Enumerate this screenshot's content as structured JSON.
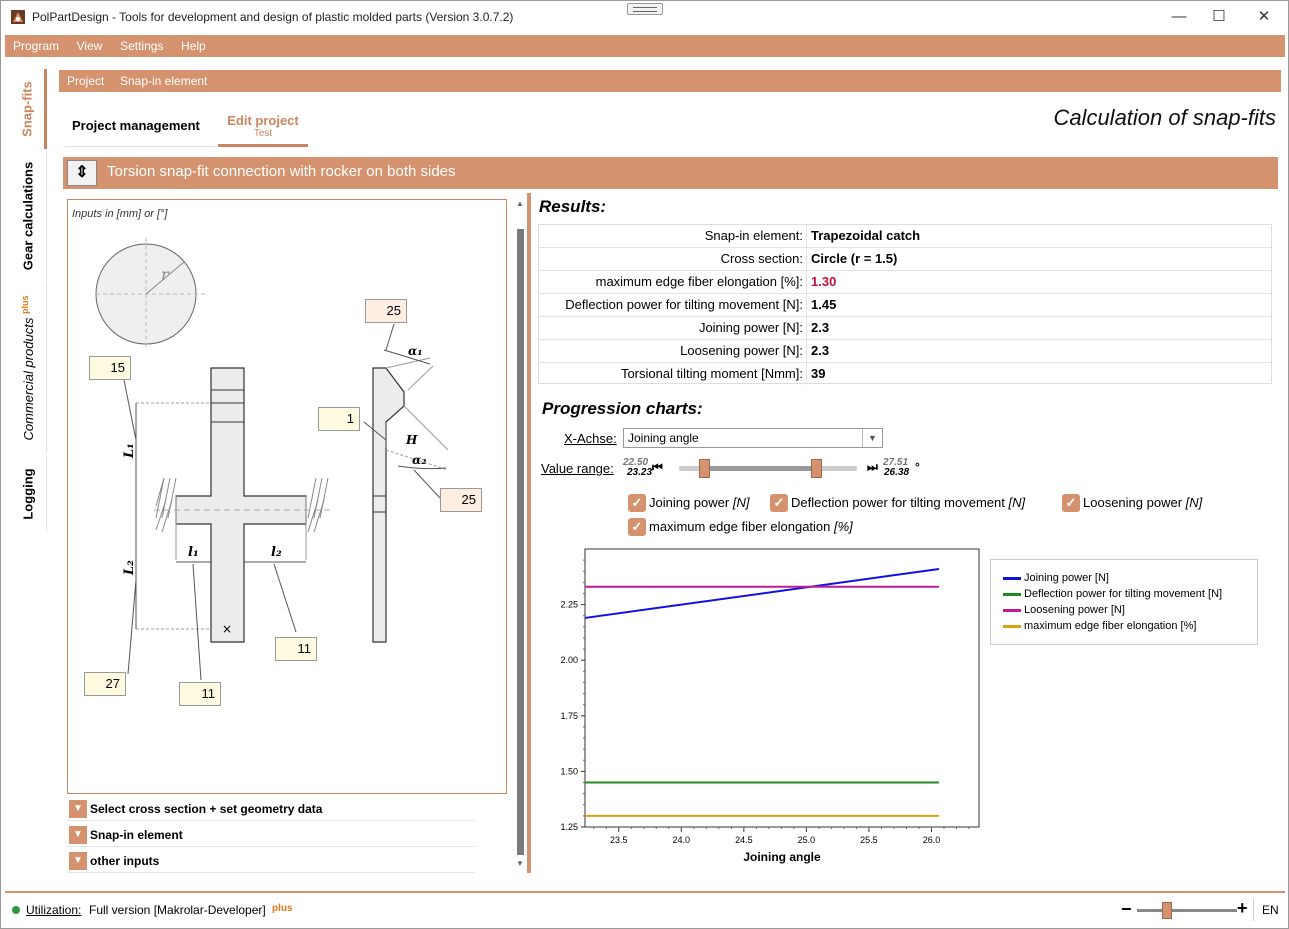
{
  "window": {
    "title": "PolPartDesign - Tools for development and design of plastic molded parts (Version 3.0.7.2)",
    "minimize": "—",
    "maximize": "☐",
    "close": "✕"
  },
  "menu": [
    "Program",
    "View",
    "Settings",
    "Help"
  ],
  "vertical_tabs": {
    "snapfits": "Snap-fits",
    "gear": "Gear calculations",
    "commercial": "Commercial products",
    "commercial_plus": "plus",
    "logging": "Logging"
  },
  "breadcrumb": [
    "Project",
    "Snap-in element"
  ],
  "tabs": {
    "project_management": "Project management",
    "edit_project": "Edit project",
    "edit_project_sub": "Test"
  },
  "calc_title": "Calculation of snap-fits",
  "section": {
    "toggle": "⇕",
    "title": "Torsion snap-fit connection with rocker on both sides"
  },
  "left": {
    "inputs_note": "Inputs in [mm] or [°]",
    "inputs": {
      "angle_top": "25",
      "height_top": "15",
      "h": "1",
      "angle_bottom": "25",
      "l2_right": "11",
      "l2_bottom": "27",
      "l1_bottom": "11"
    },
    "labels": {
      "r": "r",
      "l1": "L₁",
      "l2": "L₂",
      "small_l1": "l₁",
      "small_l2": "l₂",
      "alpha1": "α₁",
      "alpha2": "α₂",
      "h": "H",
      "x": "×"
    },
    "accordion": [
      "Select cross section + set geometry data",
      "Snap-in element",
      "other inputs"
    ]
  },
  "results": {
    "title": "Results:",
    "rows": [
      {
        "label": "Snap-in element:",
        "value": "Trapezoidal catch"
      },
      {
        "label": "Cross section:",
        "value": "Circle (r = 1.5)"
      },
      {
        "label": "maximum edge fiber elongation [%]:",
        "value": "1.30"
      },
      {
        "label": "Deflection power for tilting movement [N]:",
        "value": "1.45"
      },
      {
        "label": "Joining power [N]:",
        "value": "2.3"
      },
      {
        "label": "Loosening power [N]:",
        "value": "2.3"
      },
      {
        "label": "Torsional tilting moment [Nmm]:",
        "value": "39"
      }
    ],
    "highlight_color": "#c0123c"
  },
  "progression": {
    "title": "Progression charts:",
    "x_axis_label": "X-Achse:",
    "x_axis_value": "Joining angle",
    "value_range_label": "Value range:",
    "range_min_top": "22.50",
    "range_min_bottom": "23.23",
    "range_max_top": "27.51",
    "range_max_bottom": "26.38",
    "range_unit": "°",
    "range_low_fraction": 0.146,
    "range_high_fraction": 0.774,
    "checkboxes": [
      {
        "label": "Joining power",
        "unit": "[N]",
        "checked": true
      },
      {
        "label": "Deflection power for tilting movement",
        "unit": "[N]",
        "checked": true
      },
      {
        "label": "Loosening power",
        "unit": "[N]",
        "checked": true
      },
      {
        "label": "maximum edge fiber elongation",
        "unit": "[%]",
        "checked": true
      }
    ],
    "checkmark": "✓"
  },
  "chart_data": {
    "type": "line",
    "xlabel": "Joining angle",
    "ylabel": "",
    "xlim": [
      23.23,
      26.38
    ],
    "ylim": [
      1.25,
      2.5
    ],
    "x_ticks": [
      "23.5",
      "24.0",
      "24.5",
      "25.0",
      "25.5",
      "26.0"
    ],
    "y_ticks": [
      "1.25",
      "1.50",
      "1.75",
      "2.00",
      "2.25"
    ],
    "grid": false,
    "legend": "right",
    "series": [
      {
        "name": "Joining power [N]",
        "color": "#1010e0",
        "x": [
          23.23,
          26.06
        ],
        "y": [
          2.19,
          2.41
        ]
      },
      {
        "name": "Deflection power for tilting movement [N]",
        "color": "#1f8a1f",
        "x": [
          23.23,
          26.06
        ],
        "y": [
          1.45,
          1.45
        ]
      },
      {
        "name": "Loosening power [N]",
        "color": "#c0189a",
        "x": [
          23.23,
          26.06
        ],
        "y": [
          2.33,
          2.33
        ]
      },
      {
        "name": "maximum edge fiber elongation [%]",
        "color": "#d8a010",
        "x": [
          23.23,
          26.06
        ],
        "y": [
          1.3,
          1.3
        ]
      }
    ]
  },
  "status": {
    "utilization_label": "Utilization:",
    "version": "Full version [Makrolar-Developer]",
    "plus": "plus",
    "zoom_minus": "−",
    "zoom_plus": "+",
    "zoom_fraction": 0.3,
    "lang": "EN"
  },
  "colors": {
    "accent": "#d4926f",
    "accent_dark": "#c8855f"
  }
}
